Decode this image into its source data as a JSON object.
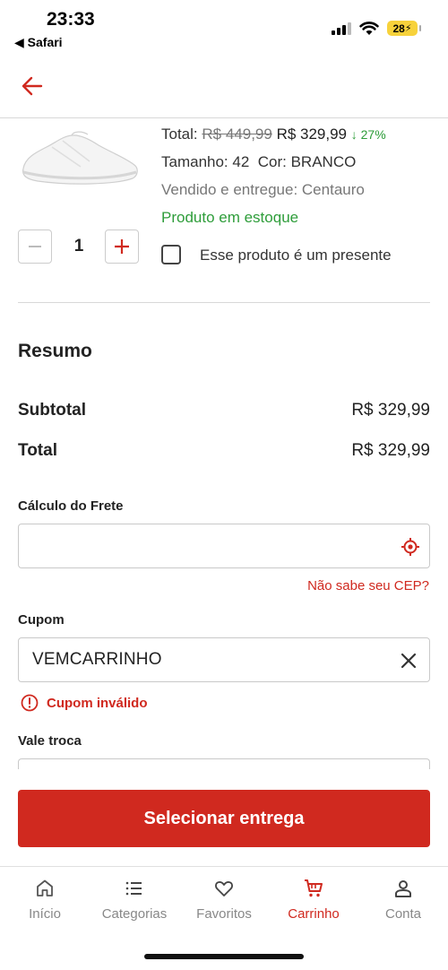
{
  "status_bar": {
    "time": "23:33",
    "back_app": "◀ Safari",
    "battery": "28"
  },
  "product": {
    "total_label": "Total:",
    "old_price": "R$ 449,99",
    "new_price": "R$ 329,99",
    "discount": "↓ 27%",
    "size": "Tamanho: 42",
    "color": "Cor: BRANCO",
    "seller": "Vendido e entregue: Centauro",
    "stock": "Produto em estoque",
    "quantity": "1",
    "gift_label": "Esse produto é um presente"
  },
  "summary": {
    "title": "Resumo",
    "subtotal_label": "Subtotal",
    "subtotal_value": "R$ 329,99",
    "total_label": "Total",
    "total_value": "R$ 329,99"
  },
  "frete": {
    "label": "Cálculo do Frete",
    "value": "",
    "link": "Não sabe seu CEP?"
  },
  "cupom": {
    "label": "Cupom",
    "value": "VEMCARRINHO",
    "error": "Cupom inválido"
  },
  "vale": {
    "label": "Vale troca"
  },
  "cta": {
    "label": "Selecionar entrega"
  },
  "tabs": [
    {
      "label": "Início",
      "icon": "home-icon"
    },
    {
      "label": "Categorias",
      "icon": "list-icon"
    },
    {
      "label": "Favoritos",
      "icon": "heart-icon"
    },
    {
      "label": "Carrinho",
      "icon": "cart-icon"
    },
    {
      "label": "Conta",
      "icon": "user-icon"
    }
  ],
  "colors": {
    "accent": "#d0291f",
    "success": "#2e9d3a"
  }
}
